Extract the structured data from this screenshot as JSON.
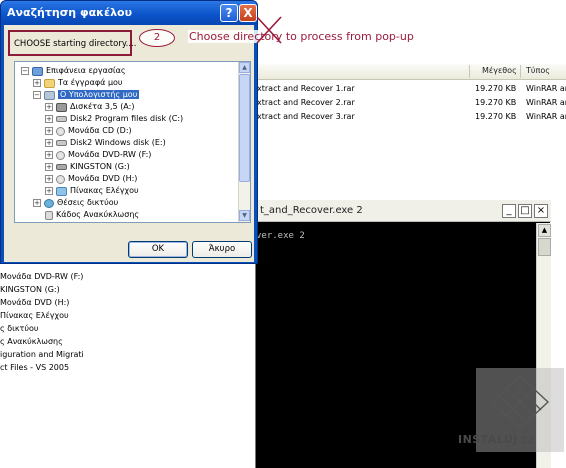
{
  "explorer": {
    "columns": {
      "size": "Μέγεθος",
      "type": "Τύπος"
    },
    "files": [
      {
        "name": "xtract and Recover 1.rar",
        "size": "19.270 KB",
        "type": "WinRAR ar"
      },
      {
        "name": "xtract and Recover 2.rar",
        "size": "19.270 KB",
        "type": "WinRAR ar"
      },
      {
        "name": "xtract and Recover 3.rar",
        "size": "19.270 KB",
        "type": "WinRAR ar"
      }
    ],
    "left_tree": [
      "Μονάδα DVD-RW (F:)",
      "KINGSTON (G:)",
      "Μονάδα DVD (H:)",
      "Πίνακας Ελέγχου",
      "ς δικτύου",
      "ς Ανακύκλωσης",
      "iguration and Migratio",
      "ct Files - VS 2005"
    ]
  },
  "console": {
    "title": "t_and_Recover.exe 2",
    "line": "ver.exe 2",
    "minimize": "_",
    "maximize": "□",
    "close": "×"
  },
  "dialog": {
    "title": "Αναζήτηση φακέλου",
    "help": "?",
    "close": "X",
    "message": "CHOOSE starting directory....",
    "ok_label": "OK",
    "cancel_label": "Άκυρο",
    "tree": [
      {
        "label": "Επιφάνεια εργασίας",
        "icon": "desktop-icon",
        "expander": "-"
      },
      {
        "label": "Τα έγγραφά μου",
        "icon": "folder-icon",
        "expander": "+"
      },
      {
        "label": "Ο Υπολογιστής μου",
        "icon": "computer-icon",
        "expander": "-",
        "selected": true
      },
      {
        "label": "Δισκέτα 3,5 (A:)",
        "icon": "floppy-icon",
        "expander": "+"
      },
      {
        "label": "Disk2 Program files disk (C:)",
        "icon": "hard-drive-icon",
        "expander": "+"
      },
      {
        "label": "Μονάδα CD (D:)",
        "icon": "cd-drive-icon",
        "expander": "+"
      },
      {
        "label": "Disk2 Windows disk (E:)",
        "icon": "hard-drive-icon",
        "expander": "+"
      },
      {
        "label": "Μονάδα DVD-RW (F:)",
        "icon": "dvd-drive-icon",
        "expander": "+"
      },
      {
        "label": "KINGSTON (G:)",
        "icon": "usb-drive-icon",
        "expander": "+"
      },
      {
        "label": "Μονάδα DVD (H:)",
        "icon": "dvd-drive-icon",
        "expander": "+"
      },
      {
        "label": "Πίνακας Ελέγχου",
        "icon": "control-panel-icon",
        "expander": "+"
      },
      {
        "label": "Θέσεις δικτύου",
        "icon": "network-icon",
        "expander": "+"
      },
      {
        "label": "Κάδος Ανακύκλωσης",
        "icon": "recycle-bin-icon",
        "expander": ""
      }
    ]
  },
  "annotation": {
    "step": "2",
    "text": "Choose directory to process from pop-up"
  },
  "watermark": {
    "text": "INSTALUJ",
    "suffix": ".CZ"
  },
  "colors": {
    "title_bar": "#0a52c8",
    "annotation": "#9b1b3c",
    "selection": "#316ac5",
    "dialog_face": "#ece9d8"
  }
}
